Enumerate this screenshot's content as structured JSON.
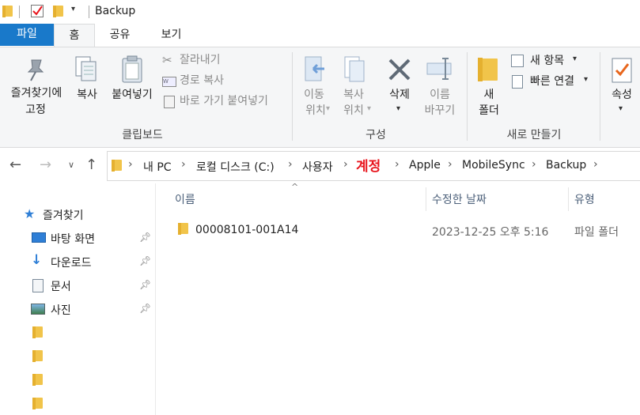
{
  "window": {
    "title": "Backup"
  },
  "tabs": [
    {
      "label": "파일"
    },
    {
      "label": "홈"
    },
    {
      "label": "공유"
    },
    {
      "label": "보기"
    }
  ],
  "ribbon": {
    "clipboard": {
      "pin_line1": "즐겨찾기에",
      "pin_line2": "고정",
      "copy": "복사",
      "paste": "붙여넣기",
      "cut": "잘라내기",
      "copy_path": "경로 복사",
      "paste_shortcut": "바로 가기 붙여넣기",
      "group": "클립보드"
    },
    "organize": {
      "move_line1": "이동",
      "move_line2": "위치",
      "copyto_line1": "복사",
      "copyto_line2": "위치",
      "delete": "삭제",
      "rename_line1": "이름",
      "rename_line2": "바꾸기",
      "group": "구성"
    },
    "new": {
      "folder_line1": "새",
      "folder_line2": "폴더",
      "new_item": "새 항목",
      "easy_access": "빠른 연결",
      "group": "새로 만들기"
    },
    "open": {
      "properties": "속성"
    }
  },
  "address": {
    "crumbs": [
      "내 PC",
      "로컬 디스크 (C:)",
      "사용자",
      "계정",
      "Apple",
      "MobileSync",
      "Backup"
    ]
  },
  "navpane": {
    "quick_access": "즐겨찾기",
    "items": [
      {
        "label": "바탕 화면"
      },
      {
        "label": "다운로드"
      },
      {
        "label": "문서"
      },
      {
        "label": "사진"
      }
    ]
  },
  "columns": {
    "name": "이름",
    "modified": "수정한 날짜",
    "type": "유형"
  },
  "files": [
    {
      "name": "00008101-001A14",
      "modified": "2023-12-25 오후 5:16",
      "type": "파일 폴더"
    }
  ],
  "colors": {
    "accent": "#1979ca",
    "highlight_red": "#e8141c",
    "folder": "#f1c44a"
  }
}
